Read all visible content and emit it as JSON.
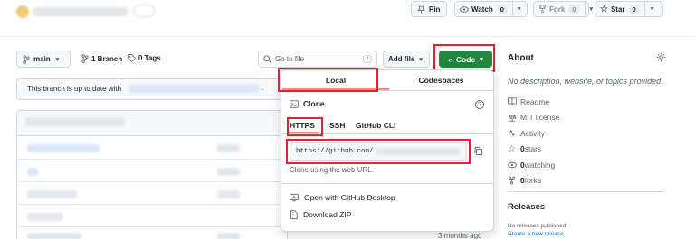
{
  "header": {
    "pin": "Pin",
    "watch": "Watch",
    "watch_count": "0",
    "fork": "Fork",
    "fork_count": "0",
    "star": "Star",
    "star_count": "0"
  },
  "toolbar": {
    "branch": "main",
    "branches": "1 Branch",
    "tags": "0 Tags",
    "goto_placeholder": "Go to file",
    "goto_key": "t",
    "add_file": "Add file",
    "code": "Code"
  },
  "branch_status": "This branch is up to date with",
  "branch_status_end": ".",
  "file_list": {
    "partial_last": "3 months ago"
  },
  "clone_popup": {
    "tabs": [
      "Local",
      "Codespaces"
    ],
    "clone_label": "Clone",
    "protocols": [
      "HTTPS",
      "SSH",
      "GitHub CLI"
    ],
    "url": "https://github.com/",
    "hint": "Clone using the web URL.",
    "open_desktop": "Open with GitHub Desktop",
    "download_zip": "Download ZIP"
  },
  "about": {
    "title": "About",
    "description": "No description, website, or topics provided.",
    "items": [
      {
        "icon": "book-icon",
        "label": "Readme",
        "bold": ""
      },
      {
        "icon": "law-icon",
        "label": "MIT license",
        "bold": ""
      },
      {
        "icon": "pulse-icon",
        "label": "Activity",
        "bold": ""
      },
      {
        "icon": "star-icon",
        "label": " stars",
        "bold": "0"
      },
      {
        "icon": "eye-icon",
        "label": " watching",
        "bold": "0"
      },
      {
        "icon": "fork-icon",
        "label": " forks",
        "bold": "0"
      }
    ]
  },
  "releases": {
    "title": "Releases",
    "none": "No releases published",
    "create": "Create a new release"
  },
  "colors": {
    "accent_green": "#1f883d",
    "highlight_red": "#e0232e",
    "link_blue": "#0969da"
  }
}
